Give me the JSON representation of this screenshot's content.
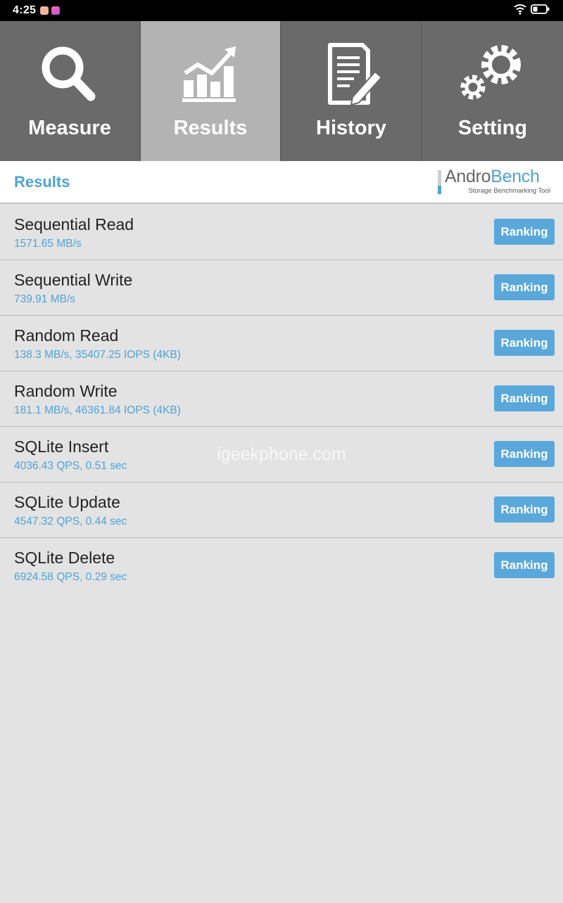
{
  "status_bar": {
    "time": "4:25",
    "icons": [
      "chat-app-icon",
      "gallery-app-icon",
      "wifi-icon",
      "battery-icon"
    ]
  },
  "tabs": [
    {
      "label": "Measure",
      "icon": "magnifier-icon",
      "active": false
    },
    {
      "label": "Results",
      "icon": "chart-icon",
      "active": true
    },
    {
      "label": "History",
      "icon": "document-pencil-icon",
      "active": false
    },
    {
      "label": "Setting",
      "icon": "gears-icon",
      "active": false
    }
  ],
  "header": {
    "title": "Results",
    "logo": {
      "part1": "Andro",
      "part2": "Bench",
      "subtitle": "Storage Benchmarking Tool"
    }
  },
  "results": [
    {
      "name": "Sequential Read",
      "value": "1571.65 MB/s",
      "button": "Ranking"
    },
    {
      "name": "Sequential Write",
      "value": "739.91 MB/s",
      "button": "Ranking"
    },
    {
      "name": "Random Read",
      "value": "138.3 MB/s, 35407.25 IOPS (4KB)",
      "button": "Ranking"
    },
    {
      "name": "Random Write",
      "value": "181.1 MB/s, 46361.84 IOPS (4KB)",
      "button": "Ranking"
    },
    {
      "name": "SQLite Insert",
      "value": "4036.43 QPS, 0.51 sec",
      "button": "Ranking"
    },
    {
      "name": "SQLite Update",
      "value": "4547.32 QPS, 0.44 sec",
      "button": "Ranking"
    },
    {
      "name": "SQLite Delete",
      "value": "6924.58 QPS, 0.29 sec",
      "button": "Ranking"
    }
  ],
  "watermark": "igeekphone.com",
  "colors": {
    "accent": "#4ea3d5",
    "button": "#5aa8db",
    "tab_bg": "#6a6a6a",
    "tab_active": "#b3b3b3",
    "list_bg": "#e3e3e3"
  }
}
